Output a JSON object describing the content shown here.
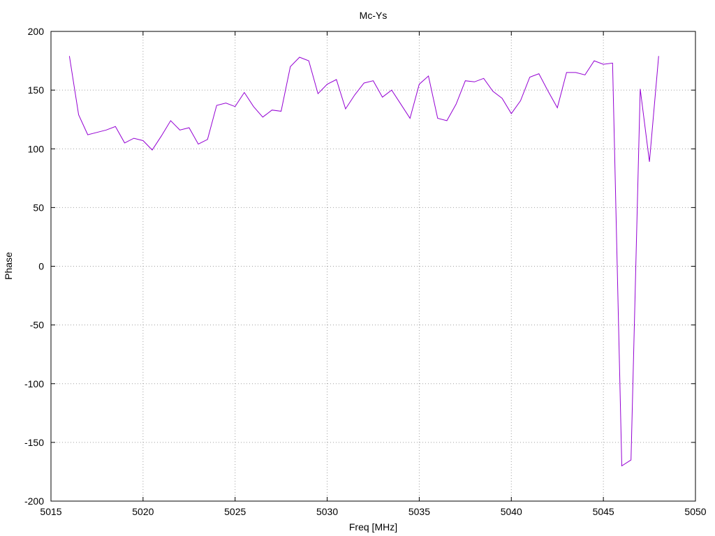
{
  "chart_data": {
    "type": "line",
    "title": "Mc-Ys",
    "xlabel": "Freq [MHz]",
    "ylabel": "Phase",
    "xlim": [
      5015,
      5050
    ],
    "ylim": [
      -200,
      200
    ],
    "xticks": [
      5015,
      5020,
      5025,
      5030,
      5035,
      5040,
      5045,
      5050
    ],
    "yticks": [
      -200,
      -150,
      -100,
      -50,
      0,
      50,
      100,
      150,
      200
    ],
    "grid": true,
    "line_color": "#9400d3",
    "series": [
      {
        "x": [
          5016.0,
          5016.5,
          5017.0,
          5017.5,
          5018.0,
          5018.5,
          5019.0,
          5019.5,
          5020.0,
          5020.5,
          5021.0,
          5021.5,
          5022.0,
          5022.5,
          5023.0,
          5023.5,
          5024.0,
          5024.5,
          5025.0,
          5025.5,
          5026.0,
          5026.5,
          5027.0,
          5027.5,
          5028.0,
          5028.5,
          5029.0,
          5029.5,
          5030.0,
          5030.5,
          5031.0,
          5031.5,
          5032.0,
          5032.5,
          5033.0,
          5033.5,
          5034.0,
          5034.5,
          5035.0,
          5035.5,
          5036.0,
          5036.5,
          5037.0,
          5037.5,
          5038.0,
          5038.5,
          5039.0,
          5039.5,
          5040.0,
          5040.5,
          5041.0,
          5041.5,
          5042.0,
          5042.5,
          5043.0,
          5043.5,
          5044.0,
          5044.5,
          5045.0,
          5045.5,
          5046.0,
          5046.5,
          5047.0,
          5047.5,
          5048.0
        ],
        "y": [
          179,
          129,
          112,
          114,
          116,
          119,
          105,
          109,
          107,
          99,
          111,
          124,
          116,
          118,
          104,
          108,
          137,
          139,
          136,
          148,
          136,
          127,
          133,
          132,
          170,
          178,
          175,
          147,
          155,
          159,
          134,
          146,
          156,
          158,
          144,
          150,
          138,
          126,
          155,
          162,
          126,
          124,
          138,
          158,
          157,
          160,
          149,
          143,
          130,
          141,
          161,
          164,
          149,
          135,
          165,
          165,
          163,
          175,
          172,
          173,
          -170,
          -165,
          151,
          89,
          179
        ]
      }
    ]
  }
}
